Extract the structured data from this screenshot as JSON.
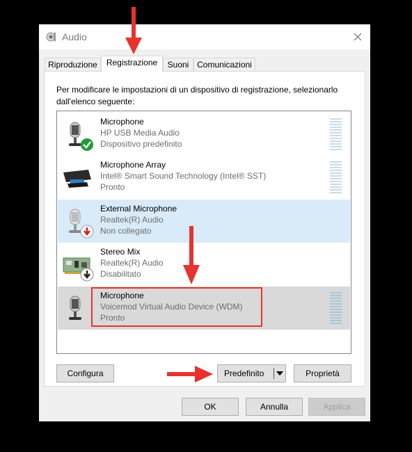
{
  "window": {
    "title": "Audio",
    "icon": "speaker-icon"
  },
  "tabs": [
    {
      "label": "Riproduzione"
    },
    {
      "label": "Registrazione",
      "active": true
    },
    {
      "label": "Suoni"
    },
    {
      "label": "Comunicazioni"
    }
  ],
  "intro_text": "Per modificare le impostazioni di un dispositivo di registrazione, selezionarlo dall'elenco seguente:",
  "devices": [
    {
      "name": "Microphone",
      "description": "HP USB Media Audio",
      "status": "Dispositivo predefinito",
      "icon": "microphone-icon",
      "badge": "default-check-icon",
      "state": "normal"
    },
    {
      "name": "Microphone Array",
      "description": "Intel® Smart Sound Technology (Intel® SST)",
      "status": "Pronto",
      "icon": "mic-array-icon",
      "state": "normal"
    },
    {
      "name": "External Microphone",
      "description": "Realtek(R) Audio",
      "status": "Non collegato",
      "icon": "microphone-icon",
      "badge": "unplugged-icon",
      "state": "hover"
    },
    {
      "name": "Stereo Mix",
      "description": "Realtek(R) Audio",
      "status": "Disabilitato",
      "icon": "sound-card-icon",
      "badge": "disabled-icon",
      "state": "normal"
    },
    {
      "name": "Microphone",
      "description": "Voicemod Virtual Audio Device (WDM)",
      "status": "Pronto",
      "icon": "microphone-icon",
      "state": "selected"
    }
  ],
  "buttons": {
    "configure": "Configura",
    "set_default": "Predefinito",
    "properties": "Proprietà",
    "ok": "OK",
    "cancel": "Annulla",
    "apply": "Applica"
  },
  "annotation_color": "#e8322f"
}
